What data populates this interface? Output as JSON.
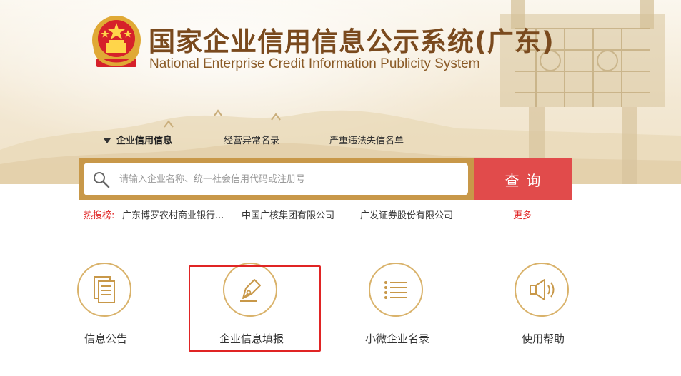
{
  "header": {
    "title_cn": "国家企业信用信息公示系统(广东)",
    "title_en": "National Enterprise Credit Information Publicity System"
  },
  "tabs": [
    {
      "label": "企业信用信息",
      "active": true
    },
    {
      "label": "经营异常名录",
      "active": false
    },
    {
      "label": "严重违法失信名单",
      "active": false
    }
  ],
  "search": {
    "placeholder": "请输入企业名称、统一社会信用代码或注册号",
    "button_label": "查询"
  },
  "hot_search": {
    "label": "热搜榜:",
    "items": [
      "广东博罗农村商业银行...",
      "中国广核集团有限公司",
      "广发证券股份有限公司"
    ],
    "more": "更多"
  },
  "features": [
    {
      "label": "信息公告",
      "icon": "document-icon"
    },
    {
      "label": "企业信息填报",
      "icon": "pen-nib-icon",
      "highlighted": true
    },
    {
      "label": "小微企业名录",
      "icon": "list-icon"
    },
    {
      "label": "使用帮助",
      "icon": "speaker-icon"
    }
  ],
  "colors": {
    "title": "#7a4a1e",
    "accent_gold": "#c89849",
    "search_button": "#e14b4b",
    "hot_label": "#e02424",
    "icon_gold": "#d9b26a",
    "highlight": "#e02424"
  }
}
